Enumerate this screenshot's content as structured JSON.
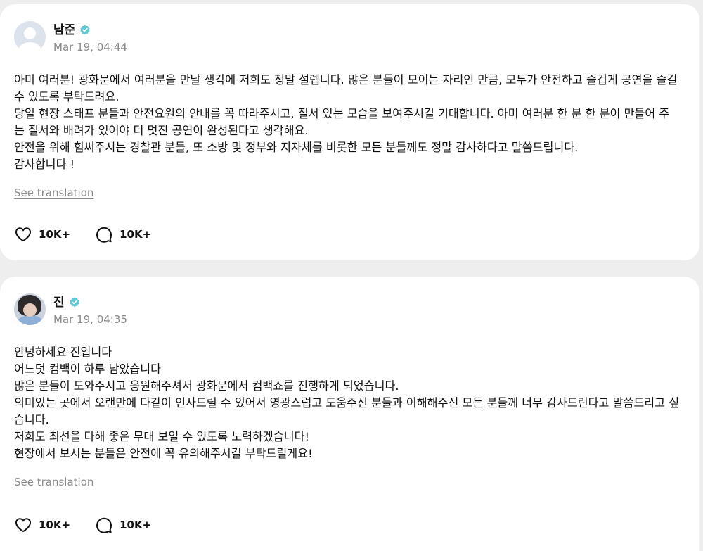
{
  "posts": [
    {
      "author": "남준",
      "timestamp": "Mar 19, 04:44",
      "avatar": "default-avatar",
      "verified": true,
      "body": [
        "아미 여러분! 광화문에서 여러분을 만날 생각에 저희도 정말 설렙니다. 많은 분들이 모이는 자리인 만큼, 모두가 안전하고 즐겁게 공연을 즐길 수 있도록 부탁드려요.",
        "당일 현장 스태프 분들과 안전요원의 안내를 꼭 따라주시고, 질서 있는 모습을 보여주시길 기대합니다. 아미 여러분 한 분 한 분이 만들어 주는 질서와 배려가 있어야 더 멋진 공연이 완성된다고 생각해요.",
        "안전을 위해 힘써주시는 경찰관 분들, 또 소방 및 정부와 지자체를 비롯한 모든 분들께도 정말 감사하다고 말씀드립니다.",
        "감사합니다 !"
      ],
      "see_translation": "See translation",
      "likes": "10K+",
      "comments": "10K+"
    },
    {
      "author": "진",
      "timestamp": "Mar 19, 04:35",
      "avatar": "profile-photo",
      "verified": true,
      "body": [
        "안녕하세요 진입니다",
        "어느덧 컴백이 하루 남았습니다",
        "많은 분들이 도와주시고 응원해주셔서 광화문에서 컴백쇼를 진행하게 되었습니다.",
        "의미있는 곳에서 오랜만에 다같이 인사드릴 수 있어서 영광스럽고 도움주신 분들과 이해해주신 모든 분들께 너무 감사드린다고 말씀드리고 싶습니다.",
        "저희도 최선을 다해 좋은 무대 보일 수 있도록 노력하겠습니다!",
        "현장에서 보시는 분들은 안전에 꼭 유의해주시길 부탁드릴게요!"
      ],
      "see_translation": "See translation",
      "likes": "10K+",
      "comments": "10K+"
    }
  ],
  "icons": {
    "verified": "verified-badge-icon",
    "like": "heart-icon",
    "comment": "comment-bubble-icon"
  },
  "colors": {
    "verified": "#5fc8d2",
    "muted_text": "#8a8a8a",
    "background": "#eeeeee",
    "card": "#ffffff"
  }
}
